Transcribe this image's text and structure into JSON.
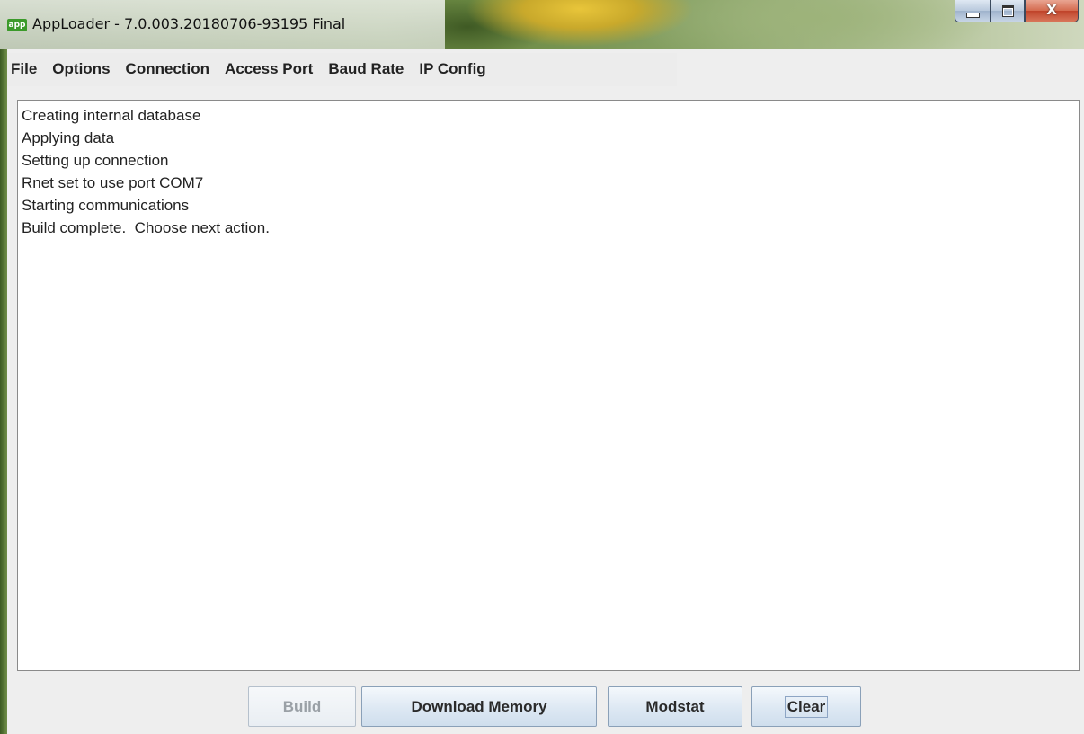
{
  "window": {
    "app_icon_text": "app",
    "title": "AppLoader - 7.0.003.20180706-93195 Final",
    "controls": {
      "minimize_icon": "minimize-icon",
      "maximize_icon": "maximize-icon",
      "close_icon": "close-icon",
      "close_glyph": "X"
    }
  },
  "menubar": {
    "items": [
      {
        "mnemonic": "F",
        "rest": "ile"
      },
      {
        "mnemonic": "O",
        "rest": "ptions"
      },
      {
        "mnemonic": "C",
        "rest": "onnection"
      },
      {
        "mnemonic": "A",
        "rest": "ccess Port"
      },
      {
        "mnemonic": "B",
        "rest": "aud Rate"
      },
      {
        "mnemonic": "I",
        "rest": "P Config"
      }
    ]
  },
  "log": {
    "lines": [
      "Creating internal database",
      "Applying data",
      "Setting up connection",
      "Rnet set to use port COM7",
      "Starting communications",
      "Build complete.  Choose next action."
    ]
  },
  "buttons": {
    "build": "Build",
    "download_memory": "Download Memory",
    "modstat": "Modstat",
    "clear": "Clear"
  }
}
